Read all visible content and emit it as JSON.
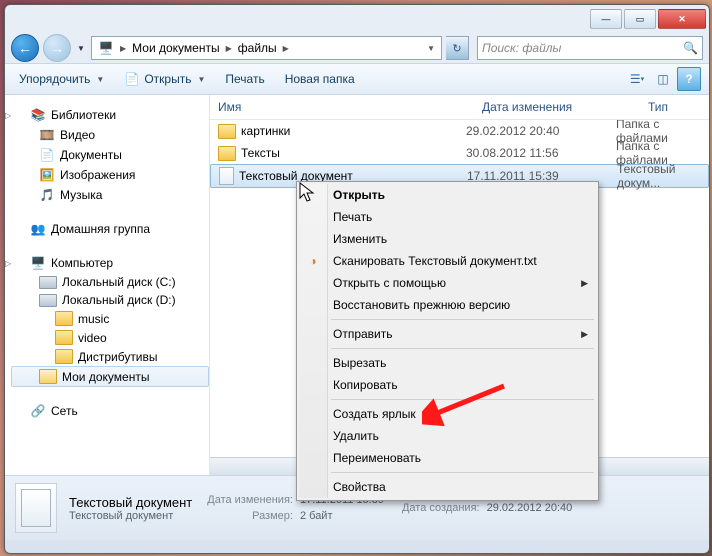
{
  "breadcrumb": {
    "seg1": "Мои документы",
    "seg2": "файлы"
  },
  "search": {
    "placeholder": "Поиск: файлы"
  },
  "toolbar": {
    "organize": "Упорядочить",
    "open": "Открыть",
    "print": "Печать",
    "new_folder": "Новая папка"
  },
  "navpane": {
    "libraries": "Библиотеки",
    "video": "Видео",
    "documents": "Документы",
    "pictures": "Изображения",
    "music": "Музыка",
    "homegroup": "Домашняя группа",
    "computer": "Компьютер",
    "drive_c": "Локальный диск (C:)",
    "drive_d": "Локальный диск (D:)",
    "d_music": "music",
    "d_video": "video",
    "d_dist": "Дистрибутивы",
    "d_mydocs": "Мои документы",
    "network": "Сеть"
  },
  "columns": {
    "name": "Имя",
    "date": "Дата изменения",
    "type": "Тип"
  },
  "rows": [
    {
      "name": "картинки",
      "date": "29.02.2012 20:40",
      "type": "Папка с файлами",
      "icon": "folder"
    },
    {
      "name": "Тексты",
      "date": "30.08.2012 11:56",
      "type": "Папка с файлами",
      "icon": "folder"
    },
    {
      "name": "Текстовый документ",
      "date": "17.11.2011 15:39",
      "type": "Текстовый докум...",
      "icon": "doc",
      "selected": true
    }
  ],
  "context_menu": {
    "open": "Открыть",
    "print": "Печать",
    "edit": "Изменить",
    "scan": "Сканировать Текстовый документ.txt",
    "open_with": "Открыть с помощью",
    "restore": "Восстановить прежнюю версию",
    "send_to": "Отправить",
    "cut": "Вырезать",
    "copy": "Копировать",
    "shortcut": "Создать ярлык",
    "delete": "Удалить",
    "rename": "Переименовать",
    "properties": "Свойства"
  },
  "details": {
    "title": "Текстовый документ",
    "subtitle": "Текстовый документ",
    "mod_label": "Дата изменения:",
    "mod_value": "17.11.2011 15:39",
    "size_label": "Размер:",
    "size_value": "2 байт",
    "created_label": "Дата создания:",
    "created_value": "29.02.2012 20:40"
  }
}
